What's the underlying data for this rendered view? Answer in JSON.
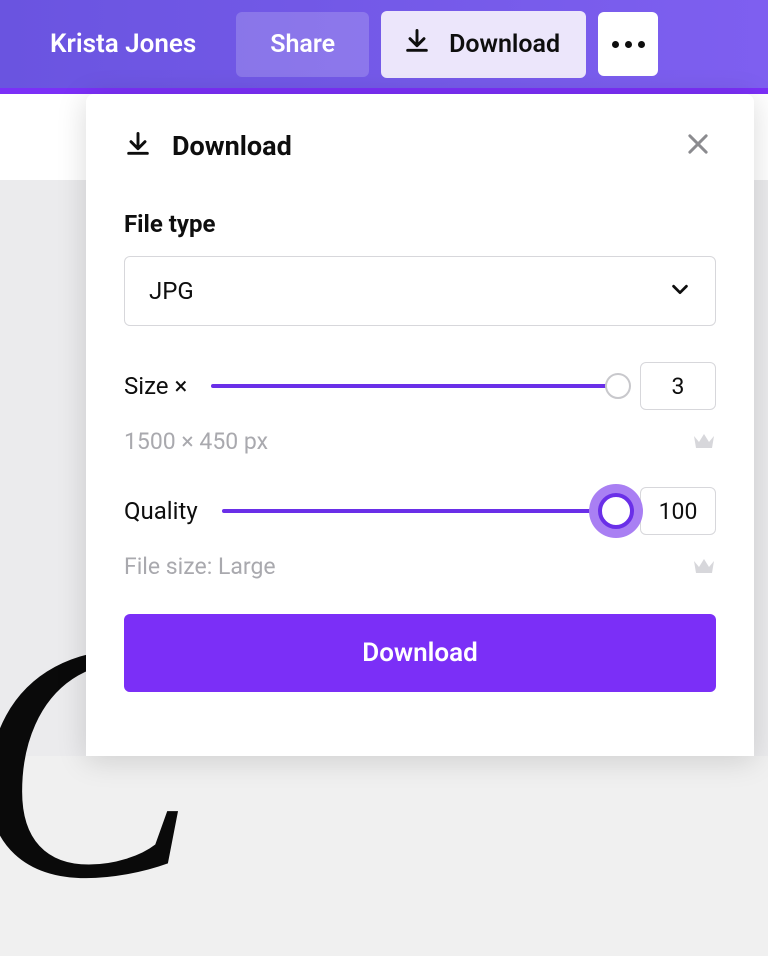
{
  "topbar": {
    "user_name": "Krista Jones",
    "share_label": "Share",
    "download_label": "Download"
  },
  "panel": {
    "title": "Download",
    "file_type_label": "File type",
    "file_type_value": "JPG",
    "size_label": "Size ×",
    "size_value": "3",
    "size_dimensions": "1500 × 450 px",
    "quality_label": "Quality",
    "quality_value": "100",
    "file_size_text": "File size: Large",
    "download_button": "Download"
  }
}
